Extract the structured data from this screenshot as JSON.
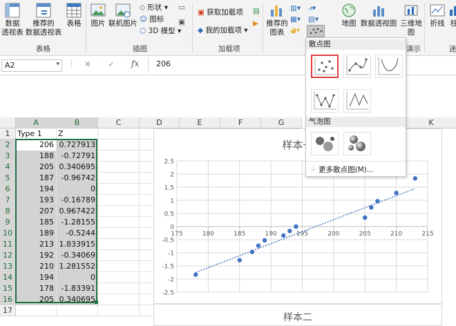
{
  "ribbon": {
    "groups": [
      {
        "label": "表格"
      },
      {
        "label": "插图"
      },
      {
        "label": "加载项"
      },
      {
        "label": "演示"
      },
      {
        "label": "迷"
      }
    ],
    "buttons": {
      "pivot": "数据\n透视表",
      "recommended_pivot": "推荐的\n数据透视表",
      "table": "表格",
      "picture": "图片",
      "online_picture": "联机图片",
      "shapes": "形状",
      "icons": "图标",
      "model3d": "3D 模型",
      "get_addins": "获取加载项",
      "my_addins": "我的加载项",
      "recommended_charts": "推荐的\n图表",
      "map": "地图",
      "pivot_chart": "数据透视图",
      "map3d": "三维地\n图",
      "line": "折线",
      "more": "柱"
    }
  },
  "formula_bar": {
    "name_box": "A2",
    "fx": "fx",
    "value": "206"
  },
  "sheet": {
    "columns": [
      "A",
      "B",
      "C",
      "D",
      "E",
      "F",
      "G",
      "K"
    ],
    "header_row": {
      "a": "Type 1",
      "b": "Z"
    },
    "rows": [
      {
        "n": "1"
      },
      {
        "n": "2",
        "a": "206",
        "b": "0.727913"
      },
      {
        "n": "3",
        "a": "188",
        "b": "-0.72791"
      },
      {
        "n": "4",
        "a": "205",
        "b": "0.340695"
      },
      {
        "n": "5",
        "a": "187",
        "b": "-0.96742"
      },
      {
        "n": "6",
        "a": "194",
        "b": "0"
      },
      {
        "n": "7",
        "a": "193",
        "b": "-0.16789"
      },
      {
        "n": "8",
        "a": "207",
        "b": "0.967422"
      },
      {
        "n": "9",
        "a": "185",
        "b": "-1.28155"
      },
      {
        "n": "10",
        "a": "189",
        "b": "-0.5244"
      },
      {
        "n": "11",
        "a": "213",
        "b": "1.833915"
      },
      {
        "n": "12",
        "a": "192",
        "b": "-0.34069"
      },
      {
        "n": "13",
        "a": "210",
        "b": "1.281552"
      },
      {
        "n": "14",
        "a": "194",
        "b": "0"
      },
      {
        "n": "15",
        "a": "178",
        "b": "-1.83391"
      },
      {
        "n": "16",
        "a": "205",
        "b": "0.340695"
      },
      {
        "n": "17"
      }
    ]
  },
  "dropdown": {
    "scatter_header": "散点图",
    "bubble_header": "气泡图",
    "more_label": "更多散点图(M)..."
  },
  "chart_data": {
    "type": "scatter",
    "title": "样本一",
    "xlim": [
      175,
      215
    ],
    "ylim": [
      -2.5,
      2.5
    ],
    "x_ticks": [
      175,
      180,
      185,
      190,
      195,
      200,
      205,
      210,
      215
    ],
    "y_ticks": [
      2.5,
      2,
      1.5,
      1,
      0.5,
      0,
      -0.5,
      -1,
      -1.5,
      -2,
      -2.5
    ],
    "points": [
      {
        "x": 206,
        "y": 0.727913
      },
      {
        "x": 188,
        "y": -0.72791
      },
      {
        "x": 205,
        "y": 0.340695
      },
      {
        "x": 187,
        "y": -0.96742
      },
      {
        "x": 194,
        "y": 0
      },
      {
        "x": 193,
        "y": -0.16789
      },
      {
        "x": 207,
        "y": 0.967422
      },
      {
        "x": 185,
        "y": -1.28155
      },
      {
        "x": 189,
        "y": -0.5244
      },
      {
        "x": 213,
        "y": 1.833915
      },
      {
        "x": 192,
        "y": -0.34069
      },
      {
        "x": 210,
        "y": 1.281552
      },
      {
        "x": 194,
        "y": 0
      },
      {
        "x": 178,
        "y": -1.83391
      },
      {
        "x": 205,
        "y": 0.340695
      }
    ],
    "trendline": {
      "type": "linear",
      "from": {
        "x": 178,
        "y": -1.75
      },
      "to": {
        "x": 213,
        "y": 1.45
      }
    },
    "grid": true,
    "point_color": "#4472c4"
  },
  "chart2": {
    "title": "样本二"
  }
}
